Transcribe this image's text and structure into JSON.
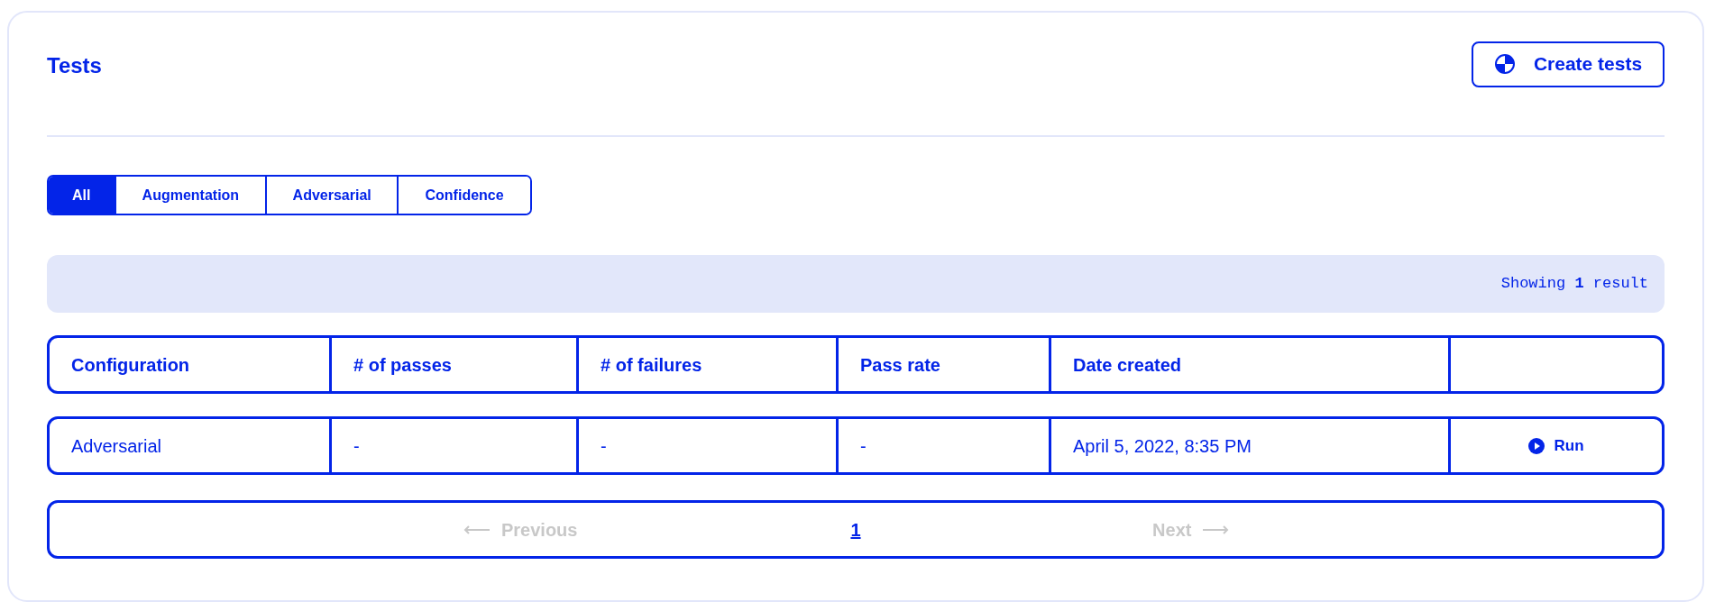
{
  "title": "Tests",
  "create_button": {
    "label": "Create tests"
  },
  "tabs": [
    {
      "label": "All",
      "selected": true
    },
    {
      "label": "Augmentation",
      "selected": false
    },
    {
      "label": "Adversarial",
      "selected": false
    },
    {
      "label": "Confidence",
      "selected": false
    }
  ],
  "result_summary": "Showing **1** result",
  "table": {
    "columns": [
      "Configuration",
      "# of passes",
      "# of failures",
      "Pass rate",
      "Date created",
      ""
    ],
    "rows": [
      {
        "cells": [
          "Adversarial",
          "-",
          "-",
          "-",
          "April 5, 2022, 8:35 PM"
        ],
        "action": "Run"
      }
    ]
  },
  "pagination": {
    "previous": {
      "label": "Previous",
      "disabled": true
    },
    "pages": [
      {
        "label": "1",
        "selected": true
      }
    ],
    "next": {
      "label": "Next",
      "disabled": true
    }
  }
}
